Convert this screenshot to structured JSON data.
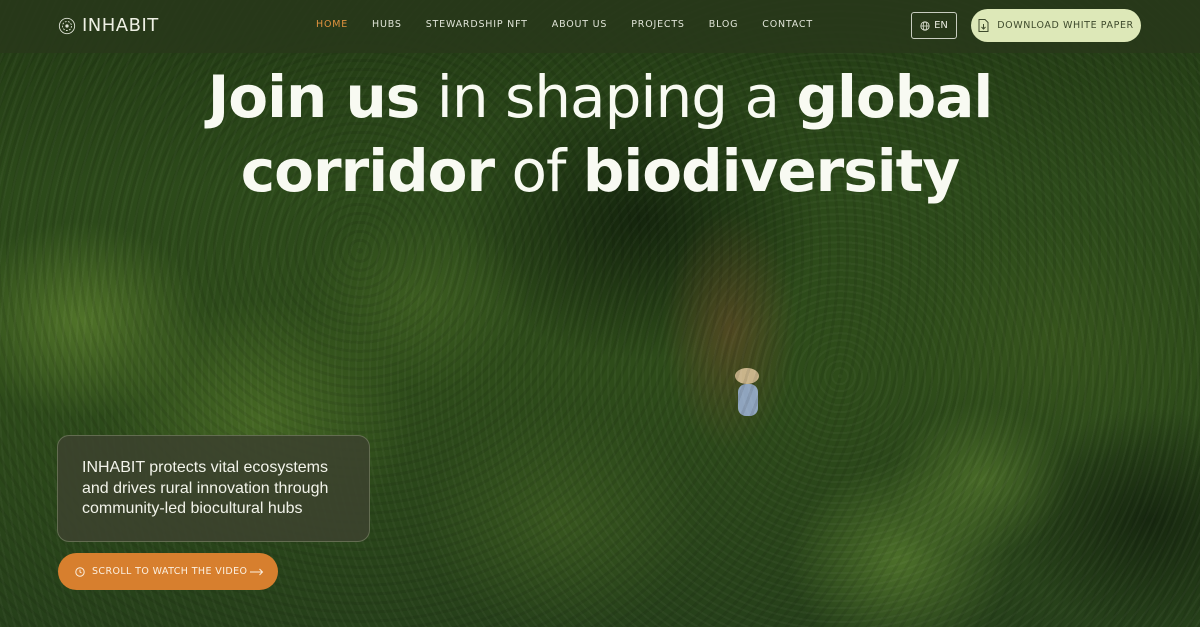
{
  "brand": {
    "logo_text": "INHABIT"
  },
  "nav": {
    "items": [
      {
        "label": "HOME",
        "active": true
      },
      {
        "label": "HUBS"
      },
      {
        "label": "STEWARDSHIP NFT"
      },
      {
        "label": "ABOUT US"
      },
      {
        "label": "PROJECTS"
      },
      {
        "label": "BLOG"
      },
      {
        "label": "CONTACT"
      }
    ],
    "lang_label": "EN",
    "cta_label": "DOWNLOAD WHITE PAPER"
  },
  "hero": {
    "line1": [
      {
        "text": "Join us",
        "weight": "bold"
      },
      {
        "text": " in shaping a ",
        "weight": "light"
      },
      {
        "text": "global",
        "weight": "bold"
      }
    ],
    "line2": [
      {
        "text": "corridor",
        "weight": "bold"
      },
      {
        "text": " of ",
        "weight": "light"
      },
      {
        "text": "biodiversity",
        "weight": "bold"
      }
    ],
    "description": "INHABIT protects vital ecosystems and drives rural innovation through community-led biocultural hubs",
    "video_button_label": "SCROLL TO WATCH THE VIDEO"
  },
  "colors": {
    "accent_orange": "#d77f2e",
    "cta_green": "#dde8b8",
    "nav_active": "#e0923e"
  },
  "icons": [
    "logo-mark-icon",
    "globe-icon",
    "document-download-icon",
    "clock-icon",
    "arrow-right-icon"
  ]
}
